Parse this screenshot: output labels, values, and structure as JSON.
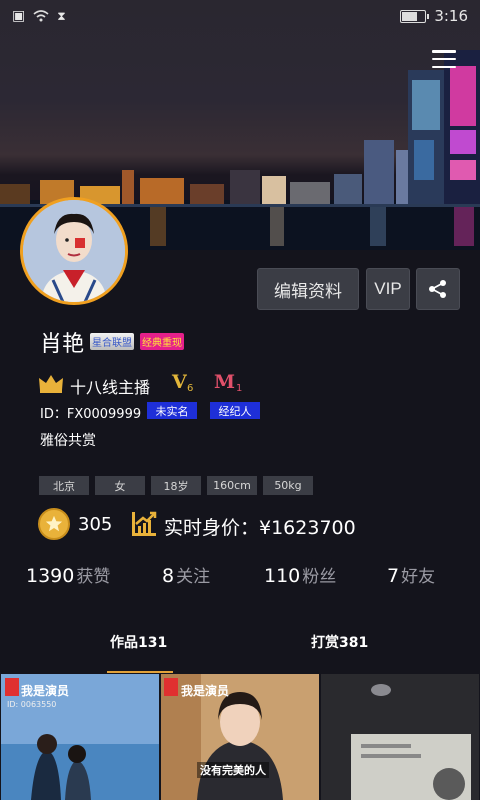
{
  "status_bar": {
    "time": "3:16"
  },
  "profile": {
    "name": "肖艳",
    "tags": [
      "星合联盟",
      "经典重现"
    ],
    "rank": "十八线主播",
    "level_v": "V",
    "level_v_num": "6",
    "level_m": "M",
    "level_m_num": "1",
    "id_text": "ID：FX0009999",
    "status_tags": [
      "未实名",
      "经纪人"
    ],
    "motto": "雅俗共赏",
    "info_tags": [
      "北京",
      "女",
      "18岁",
      "160cm",
      "50kg"
    ],
    "coins": "305",
    "valuation": "实时身价：¥1623700"
  },
  "actions": {
    "edit_label": "编辑资料",
    "vip_label": "VIP"
  },
  "stats": [
    {
      "num": "1390",
      "label": "获赞"
    },
    {
      "num": "8",
      "label": "关注"
    },
    {
      "num": "110",
      "label": "粉丝"
    },
    {
      "num": "7",
      "label": "好友"
    }
  ],
  "tabs": [
    {
      "label": "作品131",
      "active": true
    },
    {
      "label": "打赏381",
      "active": false
    }
  ],
  "thumbnails": [
    {
      "caption": "我是演员",
      "subcaption": "ID: 0063550"
    },
    {
      "caption": "我是演员",
      "overlay": "没有完美的人"
    },
    {
      "caption": ""
    }
  ],
  "colors": {
    "accent_gold": "#e2a23a",
    "tag_blue": "#1e2fd8",
    "tag_pink": "#e5208a",
    "button_bg": "#3b3d45",
    "page_bg": "#14141c"
  },
  "icons": [
    "wifi-icon",
    "sim-icon",
    "hourglass-icon",
    "battery-icon",
    "menu-icon",
    "share-icon",
    "crown-icon",
    "coin-star-icon",
    "trend-up-icon"
  ]
}
